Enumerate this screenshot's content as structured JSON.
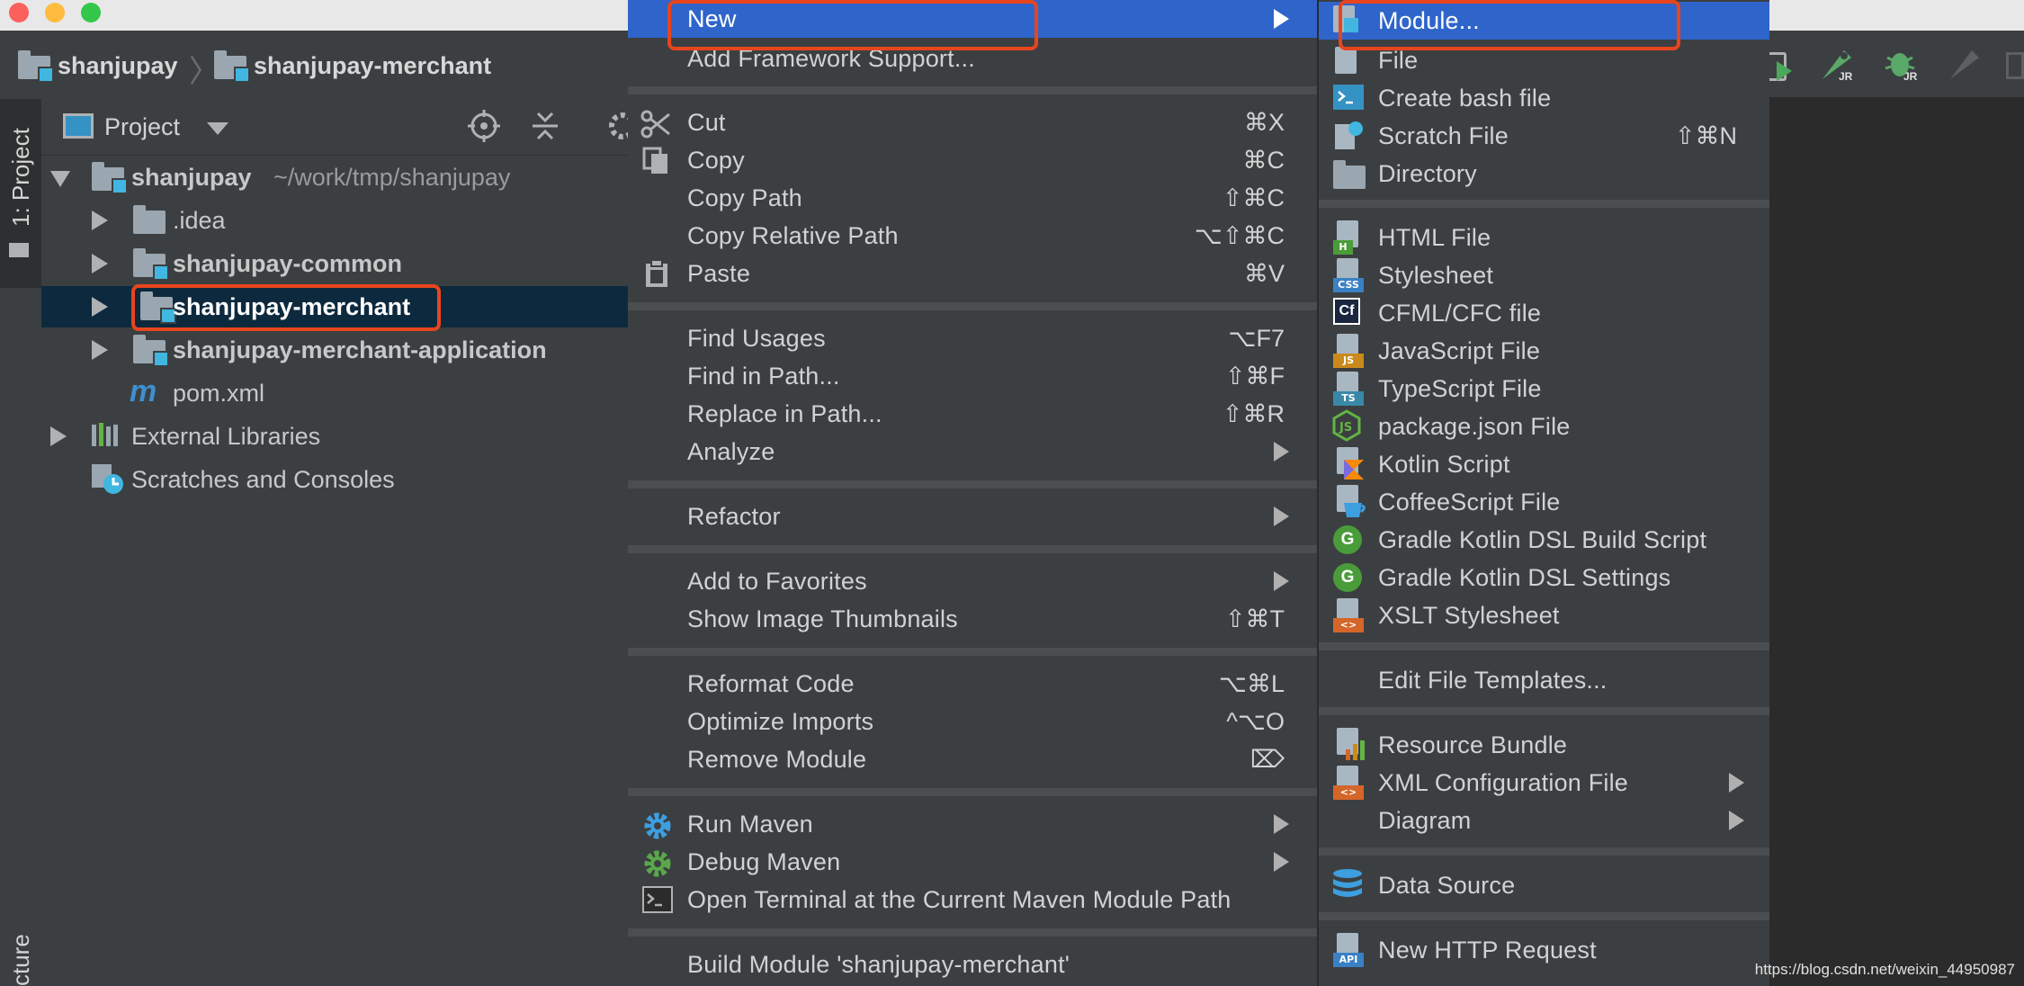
{
  "nav": {
    "root": "shanjupay",
    "module": "shanjupay-merchant"
  },
  "side_tabs": {
    "project": "1: Project",
    "structure": "cture"
  },
  "project_panel": {
    "view_label": "Project",
    "tree": [
      {
        "name": "shanjupay",
        "path": "~/work/tmp/shanjupay"
      },
      {
        "name": ".idea"
      },
      {
        "name": "shanjupay-common"
      },
      {
        "name": "shanjupay-merchant"
      },
      {
        "name": "shanjupay-merchant-application"
      },
      {
        "name": "pom.xml"
      },
      {
        "name": "External Libraries"
      },
      {
        "name": "Scratches and Consoles"
      }
    ]
  },
  "context_menu": {
    "items": [
      {
        "label": "New"
      },
      {
        "label": "Add Framework Support..."
      },
      {
        "label": "Cut",
        "shortcut": "⌘X"
      },
      {
        "label": "Copy",
        "shortcut": "⌘C"
      },
      {
        "label": "Copy Path",
        "shortcut": "⇧⌘C"
      },
      {
        "label": "Copy Relative Path",
        "shortcut": "⌥⇧⌘C"
      },
      {
        "label": "Paste",
        "shortcut": "⌘V"
      },
      {
        "label": "Find Usages",
        "shortcut": "⌥F7"
      },
      {
        "label": "Find in Path...",
        "shortcut": "⇧⌘F"
      },
      {
        "label": "Replace in Path...",
        "shortcut": "⇧⌘R"
      },
      {
        "label": "Analyze"
      },
      {
        "label": "Refactor"
      },
      {
        "label": "Add to Favorites"
      },
      {
        "label": "Show Image Thumbnails",
        "shortcut": "⇧⌘T"
      },
      {
        "label": "Reformat Code",
        "shortcut": "⌥⌘L"
      },
      {
        "label": "Optimize Imports",
        "shortcut": "^⌥O"
      },
      {
        "label": "Remove Module",
        "shortcut": "⌦"
      },
      {
        "label": "Run Maven"
      },
      {
        "label": "Debug Maven"
      },
      {
        "label": "Open Terminal at the Current Maven Module Path"
      },
      {
        "label": "Build Module 'shanjupay-merchant'"
      }
    ]
  },
  "new_submenu": {
    "items": [
      {
        "label": "Module..."
      },
      {
        "label": "File"
      },
      {
        "label": "Create bash file"
      },
      {
        "label": "Scratch File",
        "shortcut": "⇧⌘N"
      },
      {
        "label": "Directory"
      },
      {
        "label": "HTML File"
      },
      {
        "label": "Stylesheet"
      },
      {
        "label": "CFML/CFC file"
      },
      {
        "label": "JavaScript File"
      },
      {
        "label": "TypeScript File"
      },
      {
        "label": "package.json File"
      },
      {
        "label": "Kotlin Script"
      },
      {
        "label": "CoffeeScript File"
      },
      {
        "label": "Gradle Kotlin DSL Build Script"
      },
      {
        "label": "Gradle Kotlin DSL Settings"
      },
      {
        "label": "XSLT Stylesheet"
      },
      {
        "label": "Edit File Templates..."
      },
      {
        "label": "Resource Bundle"
      },
      {
        "label": "XML Configuration File"
      },
      {
        "label": "Diagram"
      },
      {
        "label": "Data Source"
      },
      {
        "label": "New HTTP Request"
      }
    ]
  },
  "icon_tags": {
    "html": "H",
    "css": "CSS",
    "cfml": "Cf",
    "js": "JS",
    "ts": "TS",
    "gradle": "G",
    "api": "API",
    "xml": "<>",
    "jr": "JR",
    "maven": "m"
  },
  "watermark": "https://blog.csdn.net/weixin_44950987",
  "colors": {
    "selection": "#2f65ca",
    "highlight_box": "#e8451d",
    "tree_selection": "#0d293e",
    "module_marker": "#40b6e0"
  }
}
